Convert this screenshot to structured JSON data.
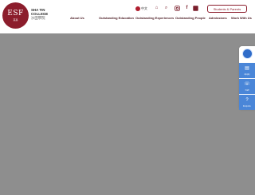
{
  "logo": {
    "text": "ESF",
    "subtitle_zh": "英基",
    "school_name_line1": "SHA TIN",
    "school_name_line2": "COLLEGE",
    "school_name_zh": "沙田學院"
  },
  "topbar": {
    "language_label": "中文",
    "icons": [
      "home-icon",
      "search-icon",
      "instagram-icon",
      "facebook-icon",
      "linkedin-icon"
    ],
    "students_parents_label": "Students & Parents"
  },
  "nav": {
    "items": [
      "About Us",
      "Outstanding Education",
      "Outstanding Experiences",
      "Outstanding People",
      "Admissions",
      "Work With Us"
    ]
  },
  "side_panel": {
    "items": [
      {
        "label": "Apply",
        "icon": "document-icon"
      },
      {
        "label": "Call",
        "icon": "phone-icon"
      },
      {
        "label": "Enquire",
        "icon": "question-icon"
      }
    ]
  },
  "colors": {
    "brand": "#8c1d2c",
    "hero": "#8e8e8e",
    "side_accent": "#4a86d8"
  }
}
